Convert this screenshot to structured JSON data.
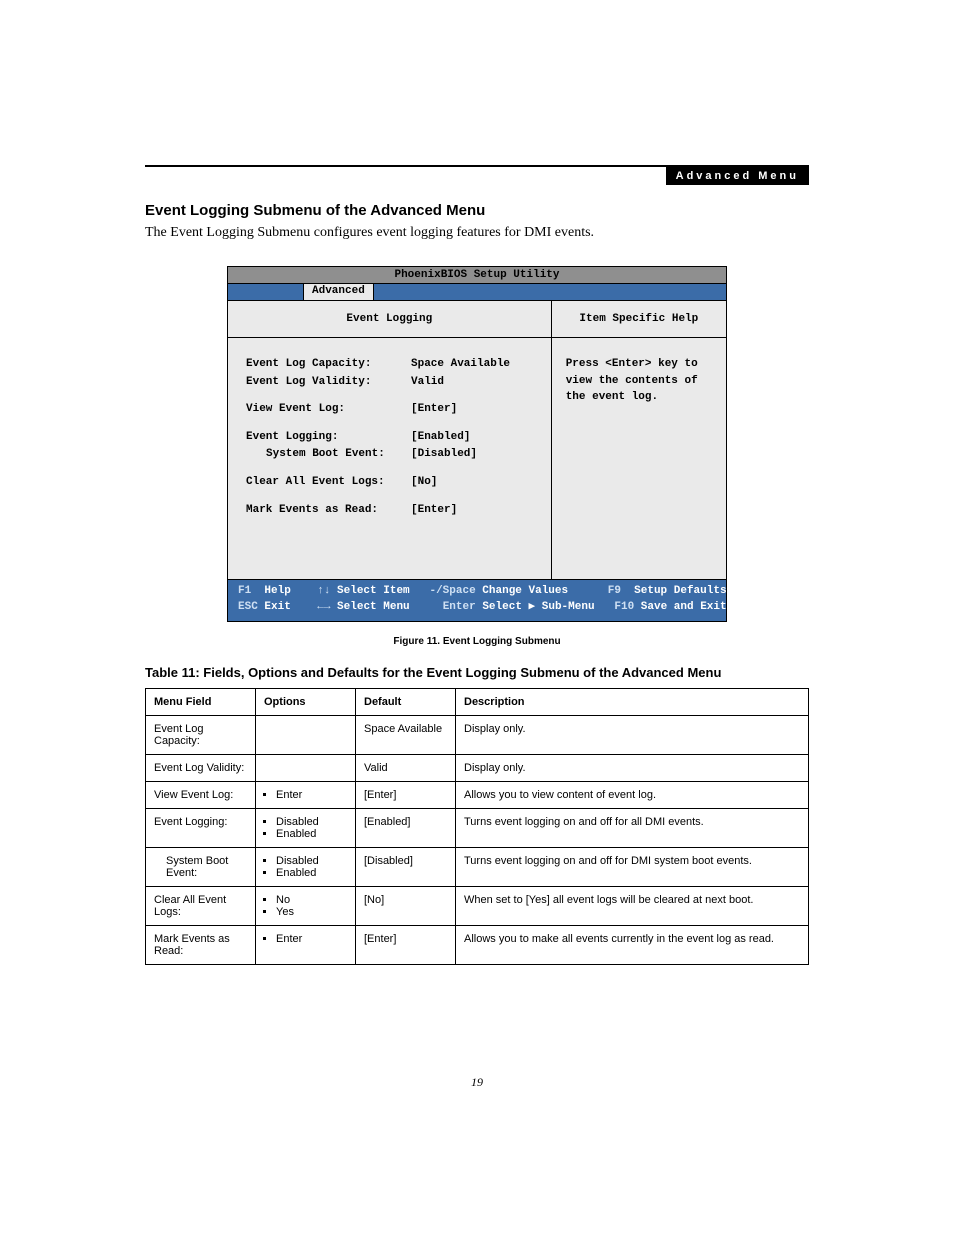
{
  "header": {
    "section": "Advanced Menu"
  },
  "title": "Event Logging Submenu of the Advanced Menu",
  "intro": "The Event Logging Submenu configures event logging features for DMI events.",
  "bios": {
    "title": "PhoenixBIOS Setup Utility",
    "active_tab": "Advanced",
    "panel_heading": "Event Logging",
    "help_heading": "Item Specific Help",
    "help_text": "Press <Enter> key to view the contents of the event log.",
    "rows": {
      "cap_label": "Event Log Capacity:",
      "cap_value": "Space Available",
      "val_label": "Event Log Validity:",
      "val_value": "Valid",
      "view_label": "View Event Log:",
      "view_value": "[Enter]",
      "log_label": "Event Logging:",
      "log_value": "[Enabled]",
      "boot_label": "System Boot Event:",
      "boot_value": "[Disabled]",
      "clear_label": "Clear All Event Logs:",
      "clear_value": "[No]",
      "mark_label": "Mark Events as Read:",
      "mark_value": "[Enter]"
    },
    "footer": {
      "f1": "F1",
      "f1_label": "Help",
      "up": "↑↓",
      "up_label": "Select Item",
      "minus": "-/Space",
      "minus_label": "Change Values",
      "f9": "F9",
      "f9_label": "Setup Defaults",
      "esc": "ESC",
      "esc_label": "Exit",
      "lr": "←→",
      "lr_label": "Select Menu",
      "enter": "Enter",
      "enter_label": "Select ▶ Sub-Menu",
      "f10": "F10",
      "f10_label": "Save and Exit"
    }
  },
  "figure_caption": "Figure 11.  Event Logging Submenu",
  "table_title": "Table 11: Fields, Options and Defaults for the Event Logging Submenu of the Advanced Menu",
  "table": {
    "headers": {
      "c1": "Menu Field",
      "c2": "Options",
      "c3": "Default",
      "c4": "Description"
    },
    "rows": [
      {
        "field": "Event Log Capacity:",
        "options": [],
        "default": "Space Available",
        "desc": "Display only.",
        "indent": false
      },
      {
        "field": "Event Log Validity:",
        "options": [],
        "default": "Valid",
        "desc": "Display only.",
        "indent": false
      },
      {
        "field": "View Event Log:",
        "options": [
          "Enter"
        ],
        "default": "[Enter]",
        "desc": "Allows you to view content of event log.",
        "indent": false
      },
      {
        "field": "Event Logging:",
        "options": [
          "Disabled",
          "Enabled"
        ],
        "default": "[Enabled]",
        "desc": "Turns event logging on and off for all DMI events.",
        "indent": false
      },
      {
        "field": "System Boot Event:",
        "options": [
          "Disabled",
          "Enabled"
        ],
        "default": "[Disabled]",
        "desc": "Turns event logging on and off for DMI system boot events.",
        "indent": true
      },
      {
        "field": "Clear All Event Logs:",
        "options": [
          "No",
          "Yes"
        ],
        "default": "[No]",
        "desc": "When set to [Yes] all event logs will be cleared at next boot.",
        "indent": false
      },
      {
        "field": "Mark Events as Read:",
        "options": [
          "Enter"
        ],
        "default": "[Enter]",
        "desc": "Allows you to make all events currently in the event log as read.",
        "indent": false
      }
    ]
  },
  "page_number": "19"
}
